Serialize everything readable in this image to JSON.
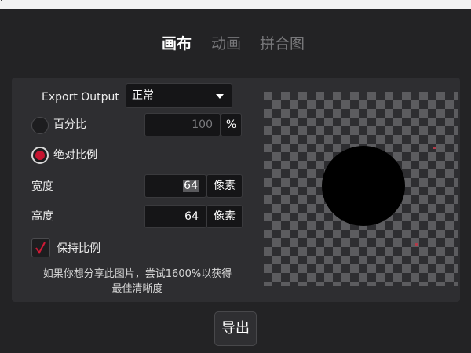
{
  "tabs": [
    {
      "label": "画布",
      "active": true
    },
    {
      "label": "动画",
      "active": false
    },
    {
      "label": "拼合图",
      "active": false
    }
  ],
  "export_output": {
    "label": "Export Output",
    "selected": "正常"
  },
  "percent": {
    "label": "百分比",
    "value": "100",
    "unit": "%",
    "checked": false
  },
  "absolute": {
    "label": "绝对比例",
    "checked": true
  },
  "width": {
    "label": "宽度",
    "value": "64",
    "unit": "像素"
  },
  "height": {
    "label": "高度",
    "value": "64",
    "unit": "像素"
  },
  "keep_ratio": {
    "label": "保持比例",
    "checked": true
  },
  "hint": {
    "line1": "如果你想分享此图片，尝试1600%以获得",
    "line2": "最佳清晰度"
  },
  "export_button": {
    "label": "导出"
  },
  "colors": {
    "background": "#232325",
    "panel": "#2e2e31",
    "accent": "#c51430"
  }
}
